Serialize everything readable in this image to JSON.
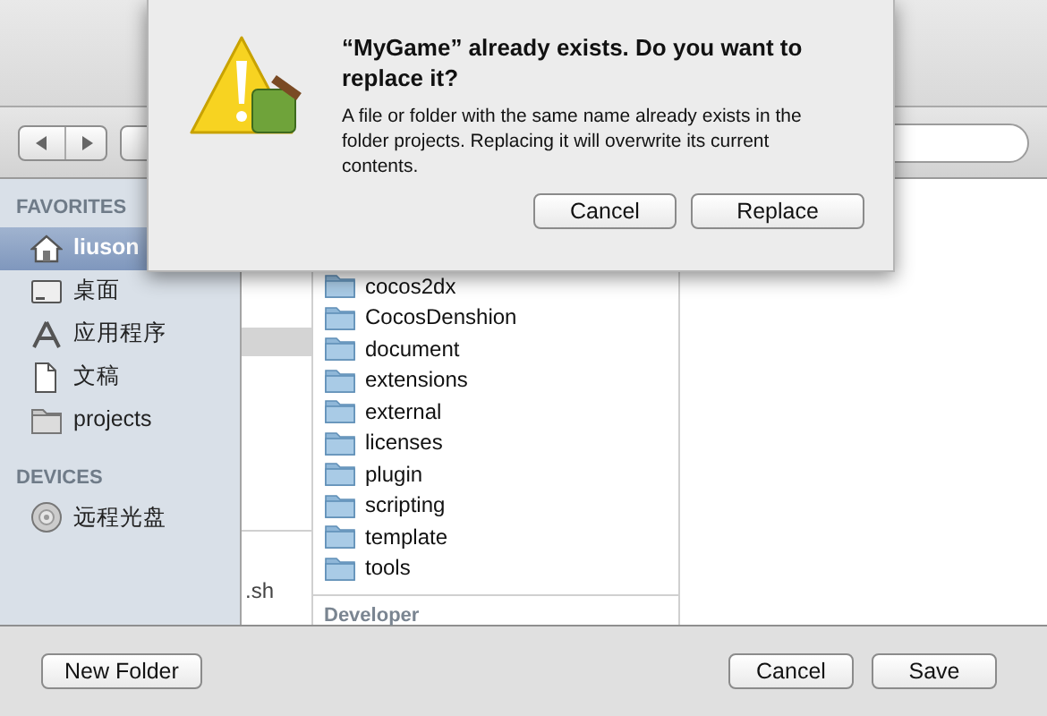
{
  "sheet": {
    "title": "“MyGame” already exists. Do you want to replace it?",
    "message": "A file or folder with the same name already exists in the folder projects. Replacing it will overwrite its current contents.",
    "buttons": [
      {
        "label": "Cancel"
      },
      {
        "label": "Replace"
      }
    ]
  },
  "sidebar": {
    "sections": [
      {
        "heading": "FAVORITES",
        "items": [
          {
            "label": "liuson",
            "kind": "home",
            "selected": true
          },
          {
            "label": "桌面",
            "kind": "desktop",
            "selected": false
          },
          {
            "label": "应用程序",
            "kind": "apps",
            "selected": false
          },
          {
            "label": "文稿",
            "kind": "document",
            "selected": false
          },
          {
            "label": "projects",
            "kind": "folder",
            "selected": false
          }
        ]
      },
      {
        "heading": "DEVICES",
        "items": [
          {
            "label": "远程光盘",
            "kind": "disc",
            "selected": false
          }
        ]
      }
    ]
  },
  "column_1": {
    "row_selected": true,
    "items": [
      ".sh"
    ]
  },
  "column_2": {
    "items": [
      "cocos2dx",
      "CocosDenshion",
      "document",
      "extensions",
      "external",
      "licenses",
      "plugin",
      "scripting",
      "template",
      "tools"
    ],
    "section": "Developer"
  },
  "footer": {
    "new_folder": "New Folder",
    "buttons": [
      "Cancel",
      "Save"
    ]
  }
}
